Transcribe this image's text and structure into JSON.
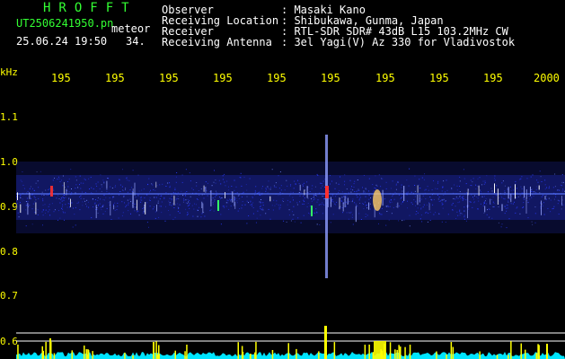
{
  "header": {
    "brand": "HROFFT",
    "filename": "UT2506241950.pn",
    "kind": "meteor",
    "datetime": "25.06.24 19:50",
    "percent": "34."
  },
  "info": [
    {
      "label": "Observer",
      "value": ": Masaki Kano"
    },
    {
      "label": "Receiving Location",
      "value": ": Shibukawa, Gunma, Japan"
    },
    {
      "label": "Receiver",
      "value": ": RTL-SDR SDR# 43dB L15 103.2MHz CW"
    },
    {
      "label": "Receiving Antenna",
      "value": ": 3el Yagi(V) Az 330 for Vladivostok"
    }
  ],
  "axis": {
    "y_unit": "kHz",
    "y_ticks": [
      "1.1",
      "1.0",
      "0.9",
      "0.8",
      "0.7",
      "0.6"
    ],
    "x_ticks": [
      "195",
      "195",
      "195",
      "195",
      "195",
      "195",
      "195",
      "195",
      "195",
      "2000"
    ]
  },
  "colors": {
    "text_green": "#33ff33",
    "text_white": "#ffffff",
    "axis_yellow": "#ffff00",
    "band_blue": "#2a3cff",
    "noise_cyan": "#00e5ff",
    "echo_red": "#ff3030"
  }
}
